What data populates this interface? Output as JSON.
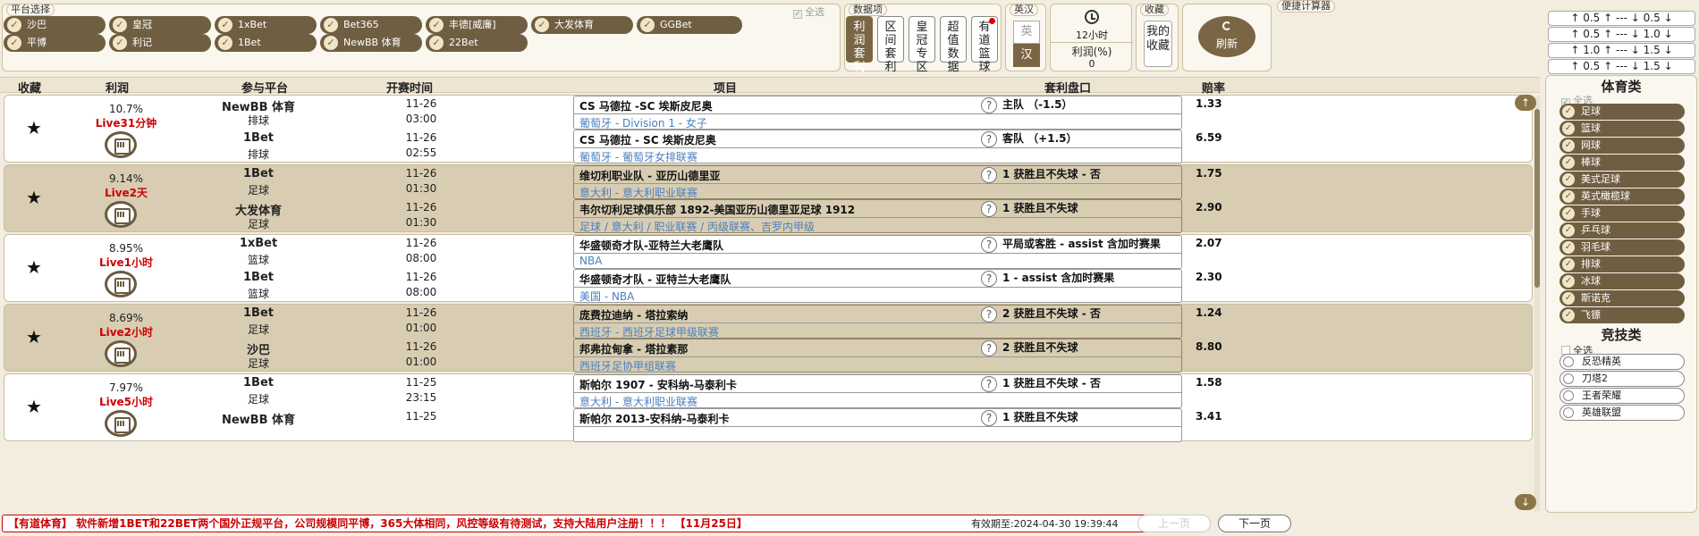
{
  "platform_panel": {
    "title": "平台选择",
    "select_all": "全选",
    "platforms": [
      "沙巴",
      "皇冠",
      "1xBet",
      "Bet365",
      "丰德[威廉]",
      "大发体育",
      "GGBet",
      "平博",
      "利记",
      "1Bet",
      "NewBB 体育",
      "22Bet"
    ]
  },
  "data_panel": {
    "title": "数据项",
    "tabs": [
      "利润套利",
      "区间套利",
      "皇冠专区",
      "超值数据",
      "有道篮球"
    ]
  },
  "lang_panel": {
    "title": "英汉",
    "en": "英",
    "zh": "汉"
  },
  "time_panel": {
    "hours": "12小时",
    "profit_label": "利润(%)",
    "profit_value": "0"
  },
  "fav_panel": {
    "title": "收藏",
    "my_fav": "我的收藏"
  },
  "refresh_label": "刷新",
  "calc_panel": {
    "title": "便捷计算器",
    "rows": [
      "↑ 0.5 ↑ --- ↓ 0.5 ↓",
      "↑ 0.5 ↑ --- ↓ 1.0 ↓",
      "↑ 1.0 ↑ --- ↓ 1.5 ↓",
      "↑ 0.5 ↑ --- ↓ 1.5 ↓"
    ]
  },
  "table_headers": [
    "收藏",
    "利润",
    "参与平台",
    "开赛时间",
    "项目",
    "套利盘口",
    "赔率"
  ],
  "rows": [
    {
      "profit": "10.7%",
      "live": "Live31分钟",
      "legs": [
        {
          "platform": "NewBB 体育",
          "sport": "排球",
          "date": "11-26",
          "time": "03:00",
          "event": "CS 马德拉 -SC 埃斯皮尼奥",
          "league": "葡萄牙 - Division 1 - 女子",
          "market": "主队 （-1.5）",
          "odds": "1.33"
        },
        {
          "platform": "1Bet",
          "sport": "排球",
          "date": "11-26",
          "time": "02:55",
          "event": "CS 马德拉 - SC 埃斯皮尼奥",
          "league": "葡萄牙 - 葡萄牙女排联赛",
          "market": "客队 （+1.5）",
          "odds": "6.59"
        }
      ]
    },
    {
      "profit": "9.14%",
      "live": "Live2天",
      "legs": [
        {
          "platform": "1Bet",
          "sport": "足球",
          "date": "11-26",
          "time": "01:30",
          "event": "维切利职业队 - 亚历山德里亚",
          "league": "意大利 - 意大利职业联赛",
          "market": "1 获胜且不失球 - 否",
          "odds": "1.75"
        },
        {
          "platform": "大发体育",
          "sport": "足球",
          "date": "11-26",
          "time": "01:30",
          "event": "韦尔切利足球俱乐部 1892-美国亚历山德里亚足球 1912",
          "league": "足球 / 意大利 / 职业联赛 / 丙级联赛、吉罗内甲级",
          "market": "1 获胜且不失球",
          "odds": "2.90"
        }
      ]
    },
    {
      "profit": "8.95%",
      "live": "Live1小时",
      "legs": [
        {
          "platform": "1xBet",
          "sport": "篮球",
          "date": "11-26",
          "time": "08:00",
          "event": "华盛顿奇才队-亚特兰大老鹰队",
          "league": "NBA",
          "market": "平局或客胜 - assist 含加时赛果",
          "odds": "2.07"
        },
        {
          "platform": "1Bet",
          "sport": "篮球",
          "date": "11-26",
          "time": "08:00",
          "event": "华盛顿奇才队 - 亚特兰大老鹰队",
          "league": "美国 - NBA",
          "market": "1 - assist 含加时赛果",
          "odds": "2.30"
        }
      ]
    },
    {
      "profit": "8.69%",
      "live": "Live2小时",
      "legs": [
        {
          "platform": "1Bet",
          "sport": "足球",
          "date": "11-26",
          "time": "01:00",
          "event": "庞费拉迪纳 - 塔拉索纳",
          "league": "西班牙 - 西班牙足球甲级联赛",
          "market": "2 获胜且不失球 - 否",
          "odds": "1.24"
        },
        {
          "platform": "沙巴",
          "sport": "足球",
          "date": "11-26",
          "time": "01:00",
          "event": "邦弗拉甸拿 - 塔拉素那",
          "league": "西班牙足协甲组联赛",
          "market": "2 获胜且不失球",
          "odds": "8.80"
        }
      ]
    },
    {
      "profit": "7.97%",
      "live": "Live5小时",
      "legs": [
        {
          "platform": "1Bet",
          "sport": "足球",
          "date": "11-25",
          "time": "23:15",
          "event": "斯帕尔 1907 - 安科纳-马泰利卡",
          "league": "意大利 - 意大利职业联赛",
          "market": "1 获胜且不失球 - 否",
          "odds": "1.58"
        },
        {
          "platform": "NewBB 体育",
          "sport": "",
          "date": "11-25",
          "time": "",
          "event": "斯帕尔 2013-安科纳-马泰利卡",
          "league": "",
          "market": "1 获胜且不失球",
          "odds": "3.41"
        }
      ]
    }
  ],
  "sports_panel": {
    "title": "体育类",
    "select_all": "全选",
    "items": [
      "足球",
      "篮球",
      "网球",
      "棒球",
      "美式足球",
      "英式橄榄球",
      "手球",
      "乒乓球",
      "羽毛球",
      "排球",
      "冰球",
      "斯诺克",
      "飞镖"
    ]
  },
  "esports_panel": {
    "title": "竞技类",
    "select_all": "全选",
    "items": [
      "反恐精英",
      "刀塔2",
      "王者荣耀",
      "英雄联盟"
    ]
  },
  "footer": {
    "notice": "【有道体育】 软件新增1BET和22BET两个国外正规平台，公司规模同平博，365大体相同，风控等级有待测试，支持大陆用户注册！！！ 【11月25日】",
    "expiry": "有效期至:2024-04-30 19:39:44",
    "prev": "上一页",
    "next": "下一页"
  },
  "colors": {
    "accent": "#6f5e42",
    "live": "#cc0000",
    "league": "#4a7fbf",
    "row_alt": "#d8cdb2"
  }
}
